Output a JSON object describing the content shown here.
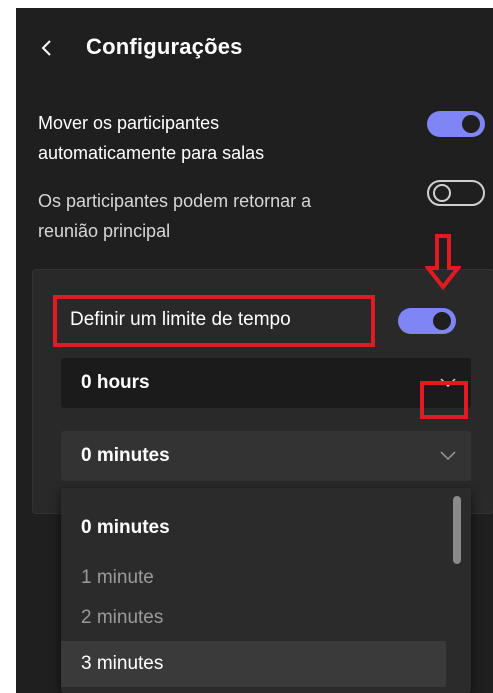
{
  "header": {
    "title": "Configurações",
    "back_icon": "chevron-left-icon"
  },
  "settings": [
    {
      "label_line1": "Mover os participantes",
      "label_line2": "automaticamente para salas",
      "enabled": true
    },
    {
      "label_line1": "Os participantes podem retornar a",
      "label_line2": "reunião principal",
      "enabled": false
    }
  ],
  "time_limit": {
    "label": "Definir um limite de tempo",
    "enabled": true,
    "hours": {
      "value": "0 hours",
      "icon": "chevron-down-icon"
    },
    "minutes": {
      "value": "0 minutes",
      "icon": "chevron-down-icon"
    },
    "minute_options": [
      "0 minutes",
      "1 minute",
      "2 minutes",
      "3 minutes"
    ],
    "selected_option": "0 minutes",
    "hovered_option": "3 minutes"
  },
  "annotation": {
    "highlight_color": "#e21b23",
    "arrow_icon": "arrow-down-icon"
  },
  "colors": {
    "accent": "#7f85f5",
    "background": "#1f1f1f"
  }
}
